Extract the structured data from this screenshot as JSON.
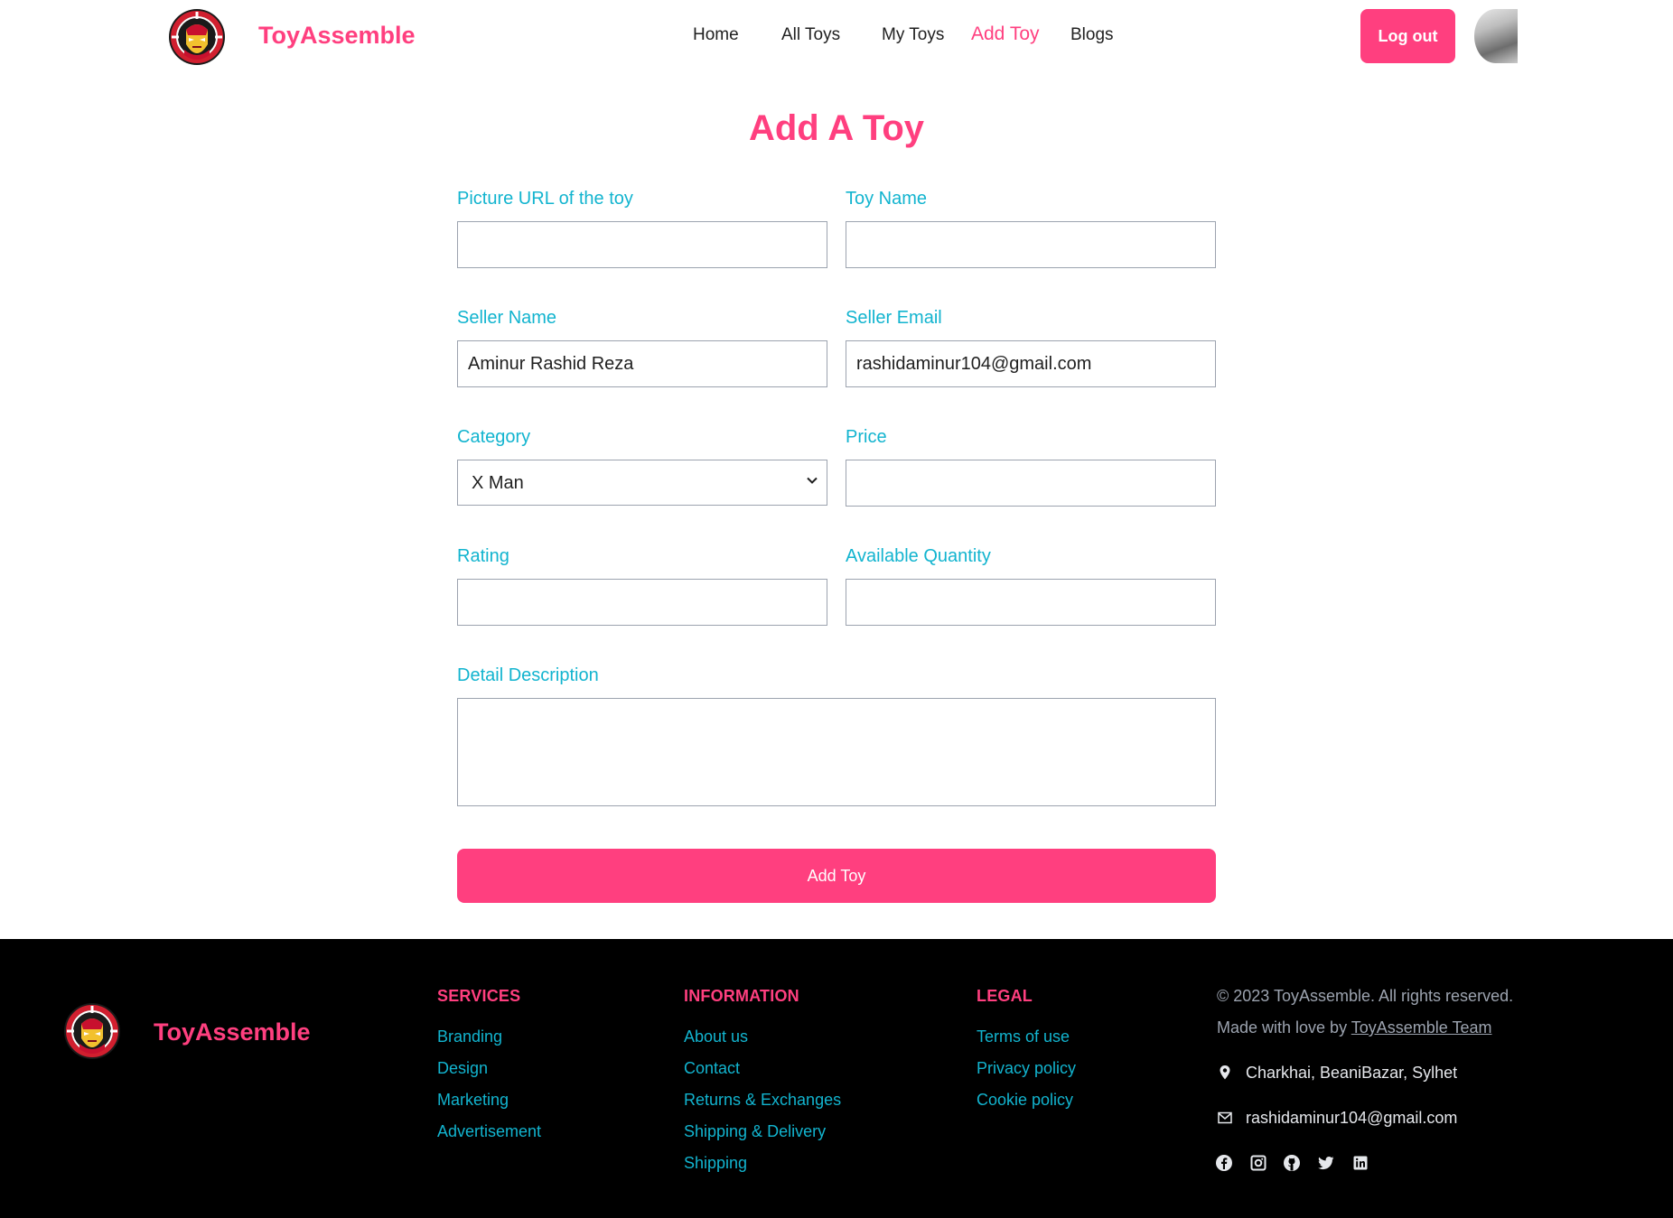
{
  "nav": {
    "brand": "ToyAssemble",
    "links": [
      "Home",
      "All Toys",
      "My Toys",
      "Add Toy",
      "Blogs"
    ],
    "active_link": "Add Toy",
    "logout_label": "Log out"
  },
  "form": {
    "title": "Add A Toy",
    "fields": {
      "picture_url": {
        "label": "Picture URL of the toy",
        "value": ""
      },
      "toy_name": {
        "label": "Toy Name",
        "value": ""
      },
      "seller_name": {
        "label": "Seller Name",
        "value": "Aminur Rashid Reza"
      },
      "seller_email": {
        "label": "Seller Email",
        "value": "rashidaminur104@gmail.com"
      },
      "category": {
        "label": "Category",
        "value": "X Man"
      },
      "price": {
        "label": "Price",
        "value": ""
      },
      "rating": {
        "label": "Rating",
        "value": ""
      },
      "available_quantity": {
        "label": "Available Quantity",
        "value": ""
      },
      "detail_description": {
        "label": "Detail Description",
        "value": ""
      }
    },
    "submit_label": "Add Toy"
  },
  "footer": {
    "brand": "ToyAssemble",
    "services": {
      "heading": "SERVICES",
      "items": [
        "Branding",
        "Design",
        "Marketing",
        "Advertisement"
      ]
    },
    "information": {
      "heading": "INFORMATION",
      "items": [
        "About us",
        "Contact",
        "Returns & Exchanges",
        "Shipping & Delivery",
        "Shipping"
      ]
    },
    "legal": {
      "heading": "LEGAL",
      "items": [
        "Terms of use",
        "Privacy policy",
        "Cookie policy"
      ]
    },
    "copyright": "© 2023 ToyAssemble. All rights reserved.",
    "made_with_prefix": "Made with love by",
    "made_with_link": "ToyAssemble Team",
    "address": "Charkhai, BeaniBazar, Sylhet",
    "email": "rashidaminur104@gmail.com",
    "socials": [
      "facebook-icon",
      "instagram-icon",
      "github-icon",
      "twitter-icon",
      "linkedin-icon"
    ]
  },
  "colors": {
    "brand_pink": "#ff3f7f",
    "label_cyan": "#12b4cf",
    "footer_bg": "#000000"
  }
}
